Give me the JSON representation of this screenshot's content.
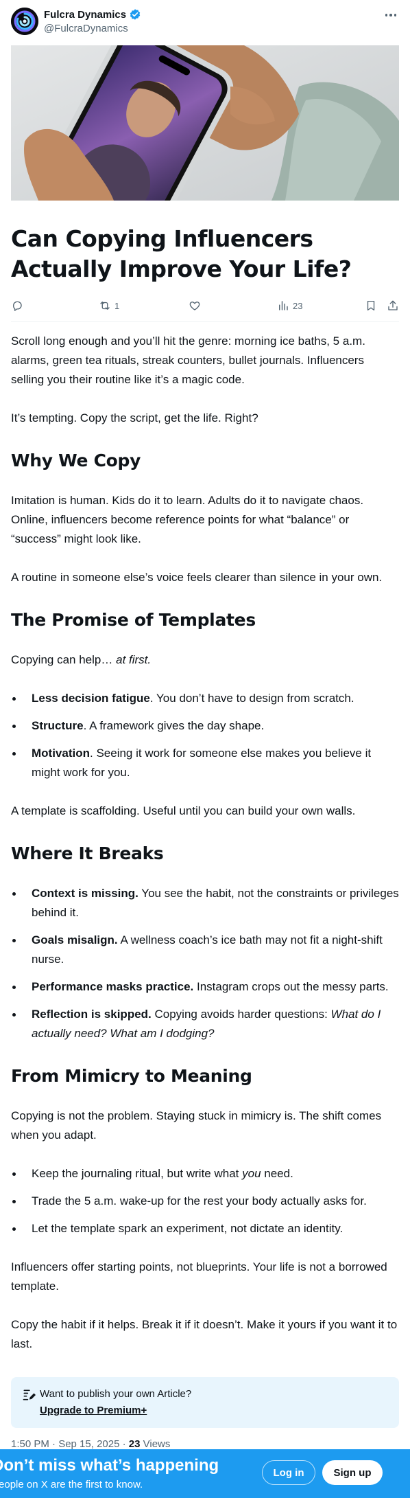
{
  "author": {
    "display_name": "Fulcra Dynamics",
    "handle": "@FulcraDynamics",
    "verified": true,
    "avatar_icon": "spiral-logo-icon"
  },
  "hero_image": {
    "alt": "hand-holding-phone-image"
  },
  "article": {
    "title": "Can Copying Influencers Actually Improve Your Life?",
    "p_intro_1": "Scroll long enough and you’ll hit the genre: morning ice baths, 5 a.m. alarms, green tea rituals, streak counters, bullet journals. Influencers selling you their routine like it’s a magic code.",
    "p_intro_2": "It’s tempting. Copy the script, get the life. Right?",
    "h_why": "Why We Copy",
    "p_why_1": "Imitation is human. Kids do it to learn. Adults do it to navigate chaos. Online, influencers become reference points for what “balance” or “success” might look like.",
    "p_why_2": "A routine in someone else’s voice feels clearer than silence in your own.",
    "h_promise": "The Promise of Templates",
    "p_promise_lead": "Copying can help…",
    "p_promise_em": "at first.",
    "promise_items": [
      {
        "bold": "Less decision fatigue",
        "text": ". You don’t have to design from scratch."
      },
      {
        "bold": "Structure",
        "text": ". A framework gives the day shape."
      },
      {
        "bold": "Motivation",
        "text": ". Seeing it work for someone else makes you believe it might work for you."
      }
    ],
    "p_promise_end": "A template is scaffolding. Useful until you can build your own walls.",
    "h_breaks": "Where It Breaks",
    "break_items": [
      {
        "bold": "Context is missing.",
        "text": " You see the habit, not the constraints or privileges behind it."
      },
      {
        "bold": "Goals misalign.",
        "text": " A wellness coach’s ice bath may not fit a night-shift nurse."
      },
      {
        "bold": "Performance masks practice.",
        "text": " Instagram crops out the messy parts."
      },
      {
        "bold": "Reflection is skipped.",
        "text": " Copying avoids harder questions: ",
        "em": "What do I actually need? What am I dodging?"
      }
    ],
    "h_mimicry": "From Mimicry to Meaning",
    "p_mimicry": "Copying is not the problem. Staying stuck in mimicry is. The shift comes when you adapt.",
    "mimicry_item_1_pre": "Keep the journaling ritual, but write what ",
    "mimicry_item_1_em": "you",
    "mimicry_item_1_post": " need.",
    "mimicry_item_2": "Trade the 5 a.m. wake-up for the rest your body actually asks for.",
    "mimicry_item_3": "Let the template spark an experiment, not dictate an identity.",
    "p_end_1": "Influencers offer starting points, not blueprints. Your life is not a borrowed template.",
    "p_end_2": "Copy the habit if it helps. Break it if it doesn’t. Make it yours if you want it to last."
  },
  "actions": {
    "reply_count": "",
    "repost_count": "1",
    "like_count": "",
    "views_count": "23"
  },
  "premium": {
    "prompt": "Want to publish your own Article?",
    "link": "Upgrade to Premium+"
  },
  "meta": {
    "timestamp": "1:50 PM · Sep 15, 2025 · ",
    "views_number": "23",
    "views_label": " Views"
  },
  "banner": {
    "title": "Don’t miss what’s happening",
    "subtitle": "People on X are the first to know.",
    "login_label": "Log in",
    "signup_label": "Sign up",
    "background": "#1d9bf0"
  }
}
